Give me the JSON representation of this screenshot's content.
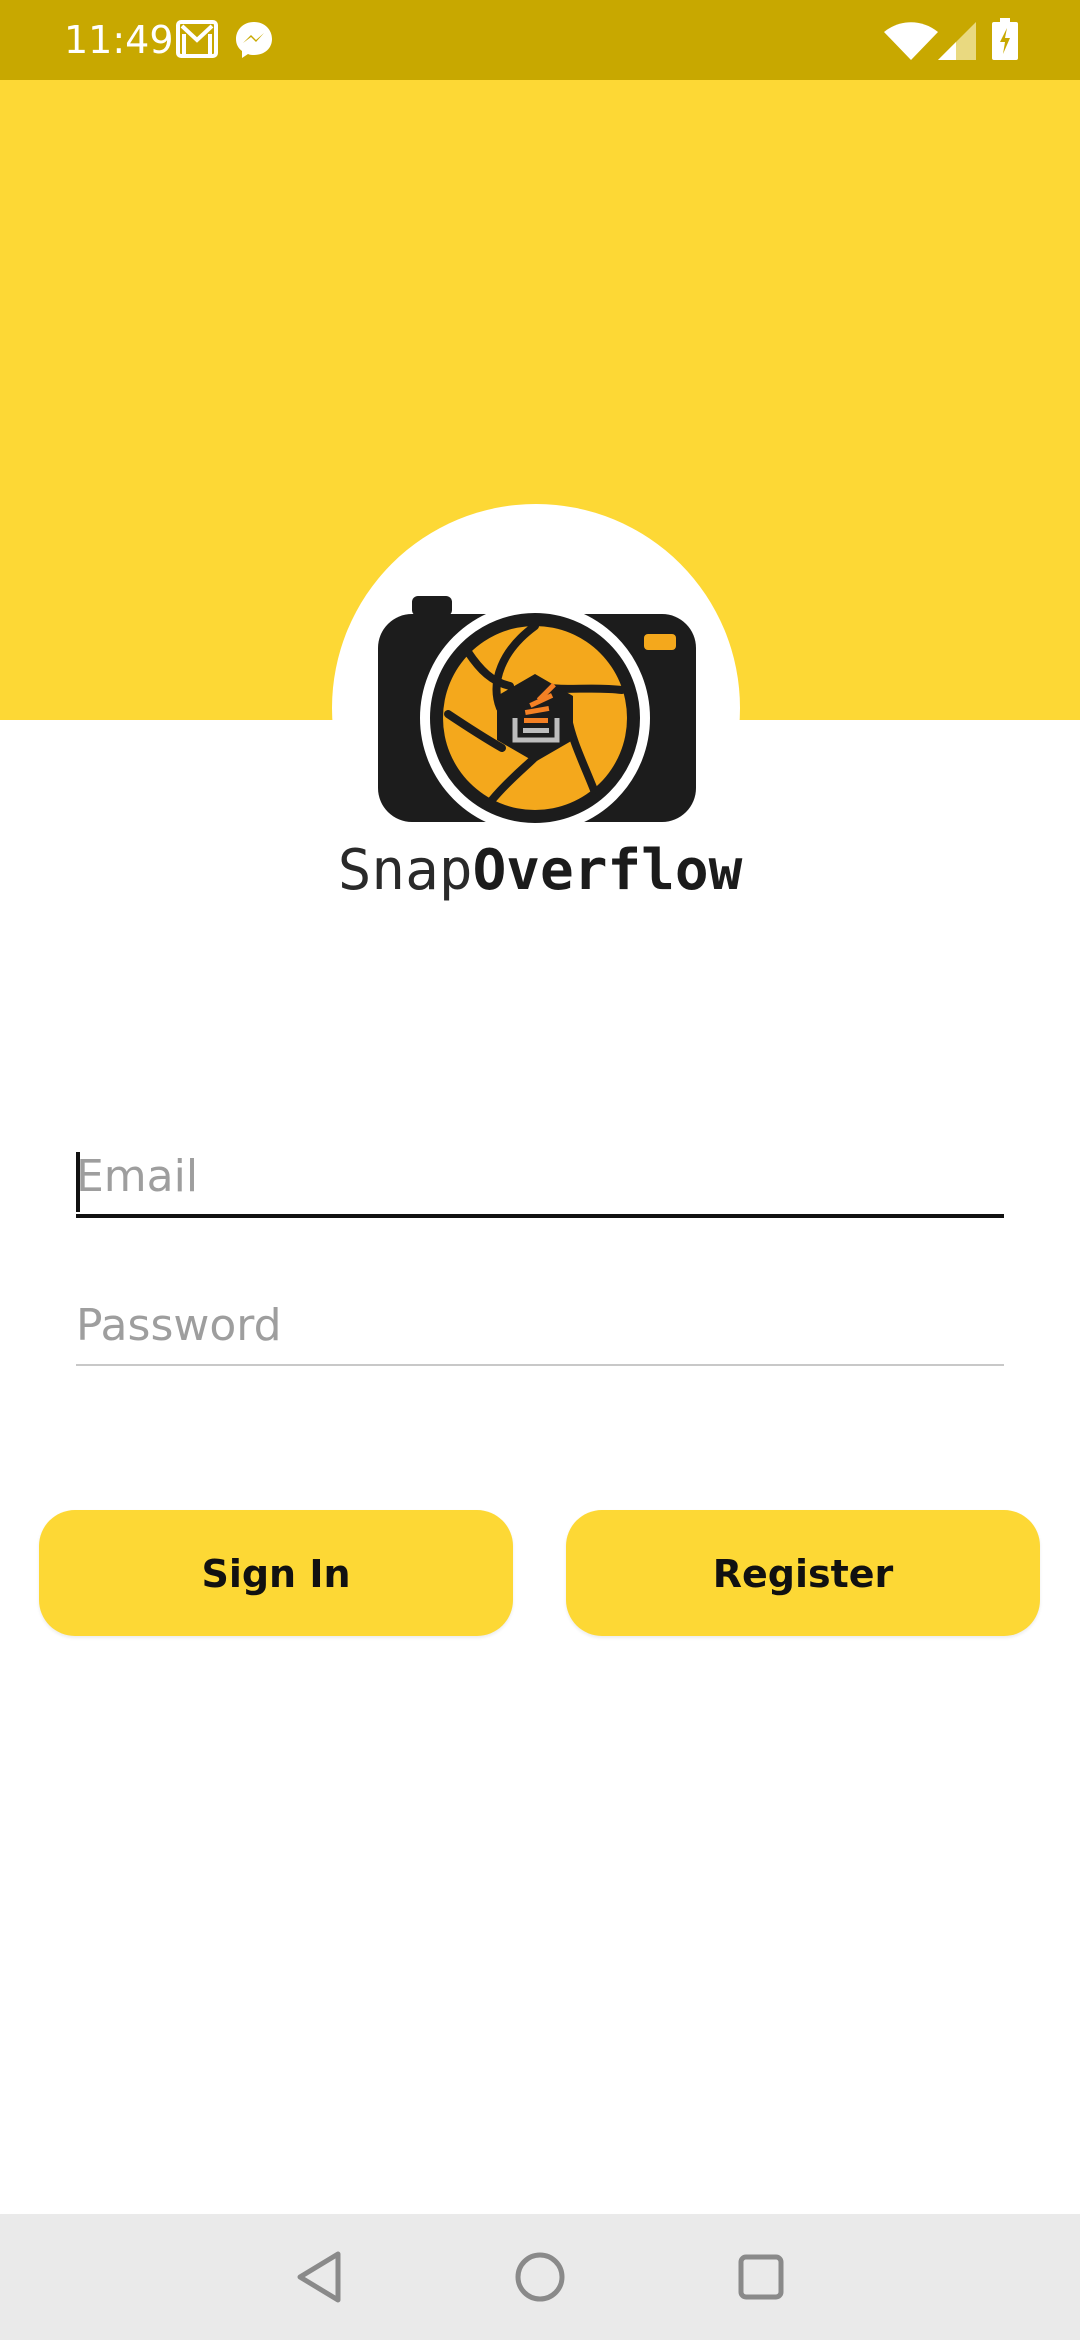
{
  "status_bar": {
    "time": "11:49",
    "icons": [
      "gmail-icon",
      "messenger-icon",
      "wifi-icon",
      "signal-icon",
      "battery-charging-icon"
    ]
  },
  "brand": {
    "part1": "Snap",
    "part2": "Overflow",
    "colors": {
      "header_yellow": "#fdd835",
      "status_bar": "#c8a800",
      "logo_orange": "#f4a81c",
      "logo_dark": "#1c1c1c"
    }
  },
  "form": {
    "email": {
      "value": "",
      "placeholder": "Email"
    },
    "password": {
      "value": "",
      "placeholder": "Password"
    }
  },
  "buttons": {
    "sign_in": "Sign In",
    "register": "Register"
  },
  "nav_bar": {
    "icons": [
      "back-icon",
      "home-icon",
      "recents-icon"
    ]
  }
}
